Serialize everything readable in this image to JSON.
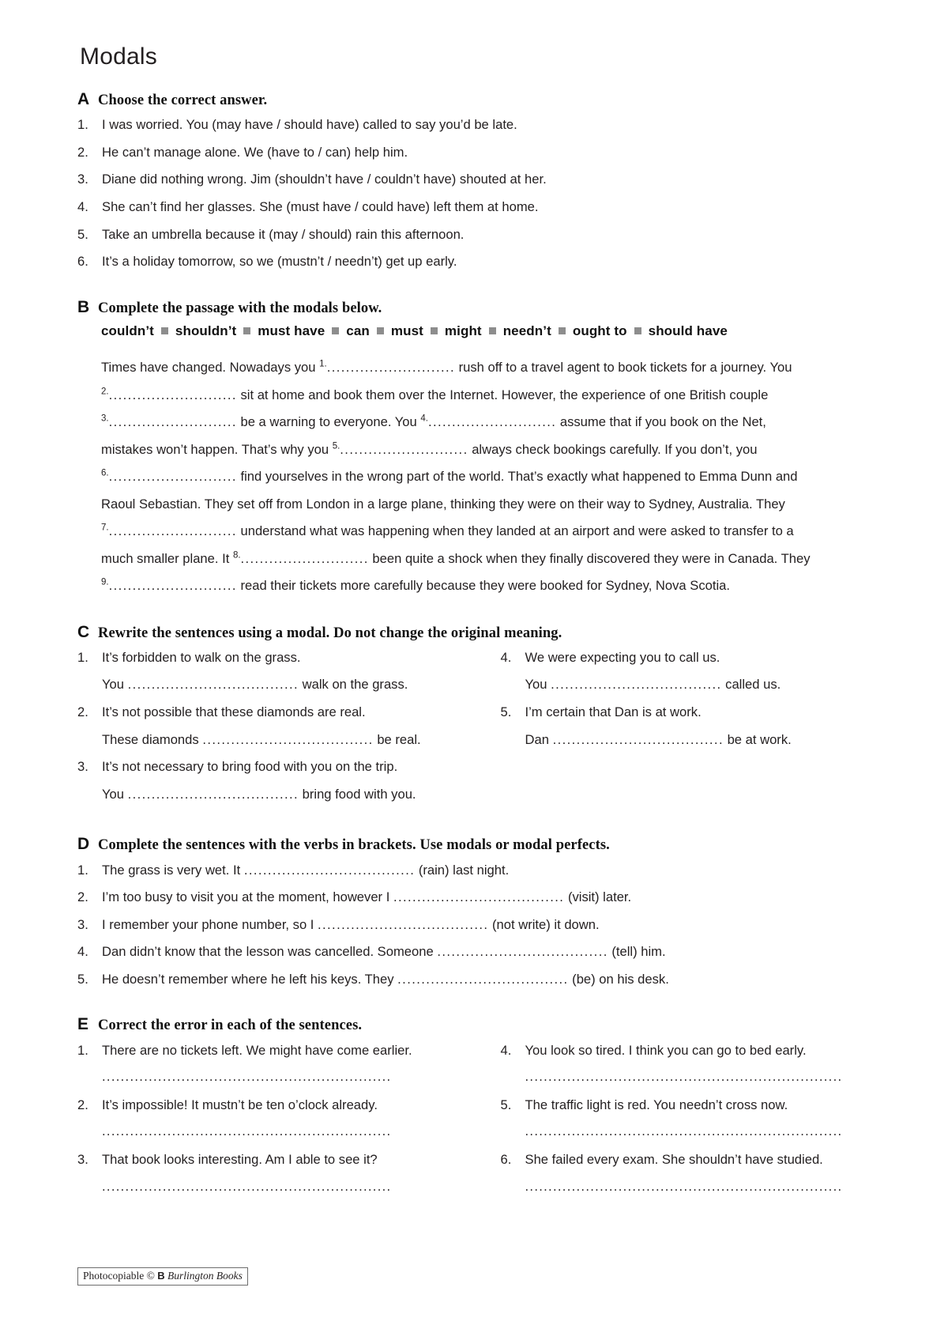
{
  "title": "Modals",
  "sections": [
    {
      "letter": "A",
      "instruction": "Choose the correct answer.",
      "items": [
        {
          "num": "1.",
          "text": "I was worried. You (may have / should have) called to say you’d be late."
        },
        {
          "num": "2.",
          "text": "He can’t manage alone. We (have to / can) help him."
        },
        {
          "num": "3.",
          "text": "Diane did nothing wrong. Jim (shouldn’t have / couldn’t have) shouted at her."
        },
        {
          "num": "4.",
          "text": "She can’t find her glasses. She (must have / could have) left them at home."
        },
        {
          "num": "5.",
          "text": "Take an umbrella because it (may / should) rain this afternoon."
        },
        {
          "num": "6.",
          "text": "It’s a holiday tomorrow, so we (mustn’t / needn’t) get up early."
        }
      ]
    },
    {
      "letter": "B",
      "instruction": "Complete the passage with the modals below.",
      "wordbank": [
        "couldn’t",
        "shouldn’t",
        "must have",
        "can",
        "must",
        "might",
        "needn’t",
        "ought to",
        "should have"
      ],
      "passage_parts": [
        {
          "type": "text",
          "value": "Times have changed. Nowadays you "
        },
        {
          "type": "blank",
          "num": "1."
        },
        {
          "type": "text",
          "value": " rush off to a travel agent to book tickets for a journey. You "
        },
        {
          "type": "blank",
          "num": "2."
        },
        {
          "type": "text",
          "value": " sit at home and book them over the Internet. However, the experience of one British couple "
        },
        {
          "type": "blank",
          "num": "3."
        },
        {
          "type": "text",
          "value": " be a warning to everyone. You "
        },
        {
          "type": "blank",
          "num": "4."
        },
        {
          "type": "text",
          "value": " assume that if you book on the Net, mistakes won’t happen. That’s why you "
        },
        {
          "type": "blank",
          "num": "5."
        },
        {
          "type": "text",
          "value": " always check bookings carefully. If you don’t, you "
        },
        {
          "type": "blank",
          "num": "6."
        },
        {
          "type": "text",
          "value": " find yourselves in the wrong part of the world. That’s exactly what happened to Emma Dunn and Raoul Sebastian. They set off from London in a large plane, thinking they were on their way to Sydney, Australia. They "
        },
        {
          "type": "blank",
          "num": "7."
        },
        {
          "type": "text",
          "value": " understand what was happening when they landed at an airport and were asked to transfer to a much smaller plane. It "
        },
        {
          "type": "blank",
          "num": "8."
        },
        {
          "type": "text",
          "value": " been quite a shock when they finally discovered they were in Canada. They "
        },
        {
          "type": "blank",
          "num": "9."
        },
        {
          "type": "text",
          "value": " read their tickets more carefully because they were booked for Sydney, Nova Scotia."
        }
      ]
    },
    {
      "letter": "C",
      "instruction": "Rewrite the sentences using a modal. Do not change the original meaning.",
      "left": [
        {
          "num": "1.",
          "text": "It’s forbidden to walk on the grass.",
          "answer_prefix": "You",
          "answer_suffix": "walk on the grass."
        },
        {
          "num": "2.",
          "text": "It’s not possible that these diamonds are real.",
          "answer_prefix": "These diamonds",
          "answer_suffix": "be real."
        },
        {
          "num": "3.",
          "text": "It’s not necessary to bring food with you on the trip.",
          "answer_prefix": "You",
          "answer_suffix": "bring food with you."
        }
      ],
      "right": [
        {
          "num": "4.",
          "text": "We were expecting you to call us.",
          "answer_prefix": "You",
          "answer_suffix": "called us."
        },
        {
          "num": "5.",
          "text": "I’m certain that Dan is at work.",
          "answer_prefix": "Dan",
          "answer_suffix": "be at work."
        }
      ]
    },
    {
      "letter": "D",
      "instruction": "Complete the sentences with the verbs in brackets. Use modals or modal perfects.",
      "items": [
        {
          "num": "1.",
          "before": "The grass is very wet. It",
          "after": "(rain) last night."
        },
        {
          "num": "2.",
          "before": "I’m too busy to visit you at the moment, however I",
          "after": "(visit) later."
        },
        {
          "num": "3.",
          "before": "I remember your phone number, so I",
          "after": "(not write) it down."
        },
        {
          "num": "4.",
          "before": "Dan didn’t know that the lesson was cancelled. Someone",
          "after": "(tell) him."
        },
        {
          "num": "5.",
          "before": "He doesn’t remember where he left his keys. They",
          "after": "(be) on his desk."
        }
      ]
    },
    {
      "letter": "E",
      "instruction": "Correct the error in each of the sentences.",
      "left": [
        {
          "num": "1.",
          "text": "There are no tickets left. We might have come earlier."
        },
        {
          "num": "2.",
          "text": "It’s impossible! It mustn’t be ten o’clock already."
        },
        {
          "num": "3.",
          "text": "That book looks interesting. Am I able to see it?"
        }
      ],
      "right": [
        {
          "num": "4.",
          "text": "You look so tired. I think you can go to bed early."
        },
        {
          "num": "5.",
          "text": "The traffic light is red. You needn’t cross now."
        },
        {
          "num": "6.",
          "text": "She failed every exam. She shouldn’t have studied."
        }
      ]
    }
  ],
  "dots": {
    "short": "....................................",
    "passage": "...........................",
    "full_left": "..............................................................",
    "full_right": "...................................................................."
  },
  "footer": {
    "photocopiable": "Photocopiable ©",
    "logo_letter": "B",
    "brand": "Burlington Books"
  }
}
